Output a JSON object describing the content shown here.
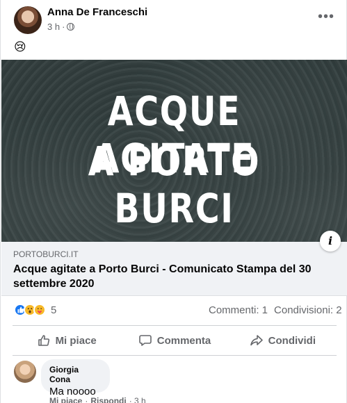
{
  "post": {
    "author": "Anna De Franceschi",
    "time": "3 h",
    "separator": "·",
    "emoji": "😢",
    "more_label": "•••"
  },
  "hero": {
    "line1": "ACQUE AGITATE",
    "line2": "A PORTO BURCI",
    "info_label": "i"
  },
  "link": {
    "domain": "PORTOBURCI.IT",
    "title": "Acque agitate a Porto Burci - Comunicato Stampa del 30 settembre 2020"
  },
  "stats": {
    "reactions_count": "5",
    "comments": "Commenti: 1",
    "shares": "Condivisioni: 2",
    "reaction_icons": [
      "like-icon",
      "wow-icon",
      "care-icon"
    ]
  },
  "actions": {
    "like": "Mi piace",
    "comment": "Commenta",
    "share": "Condividi"
  },
  "comment": {
    "name": "Giorgia Cona",
    "text": "Ma noooo",
    "like": "Mi piace",
    "dot": "·",
    "reply": "Rispondi",
    "time": "· 3 h"
  },
  "colors": {
    "brand_blue": "#1877f2",
    "secondary_text": "#65676b",
    "link_bg": "#f0f2f5"
  }
}
